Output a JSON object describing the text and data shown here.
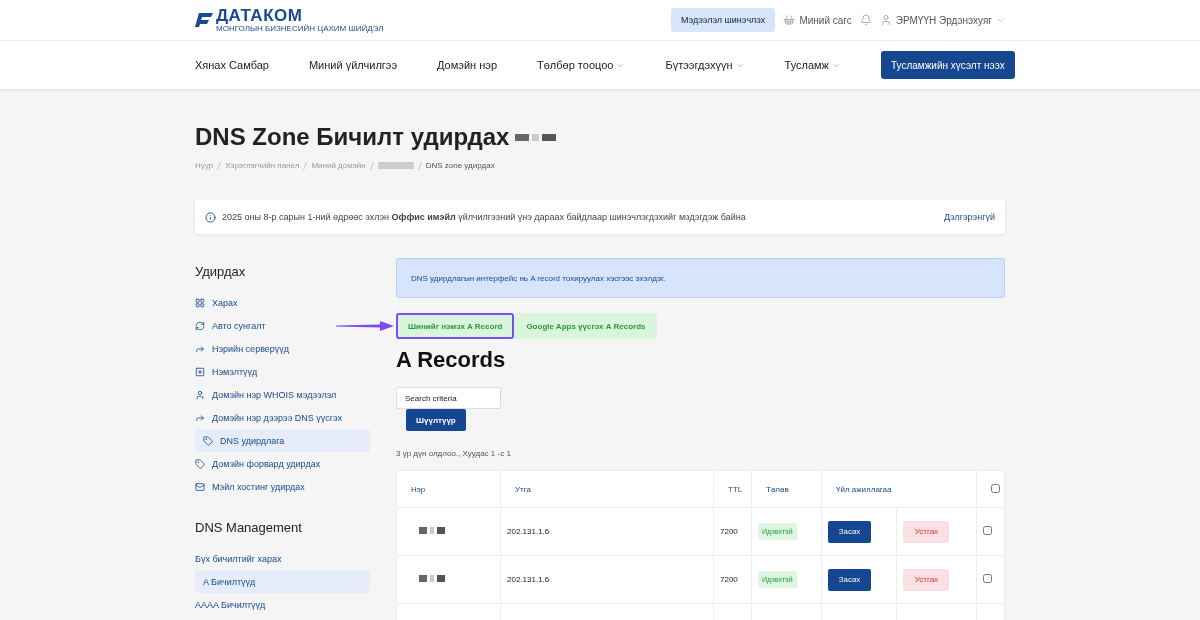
{
  "topbar": {
    "logo": "ДАТАКОМ",
    "logo_tagline": "МОНГОЛЫН БИЗНЕСИЙН ЦАХИМ ШИЙДЭЛ",
    "update_button": "Мэдээлэл шинэчлэх",
    "cart": "Миний сагс",
    "user": "ЭРМҮҮН Эрдэнэхуяг"
  },
  "nav": {
    "items": [
      {
        "label": "Хянах Самбар",
        "dropdown": false
      },
      {
        "label": "Миний үйлчилгээ",
        "dropdown": false
      },
      {
        "label": "Домэйн нэр",
        "dropdown": false
      },
      {
        "label": "Төлбөр тооцоо",
        "dropdown": true
      },
      {
        "label": "Бүтээгдэхүүн",
        "dropdown": true
      },
      {
        "label": "Тусламж",
        "dropdown": true
      }
    ],
    "support_button": "Тусламжийн хүсэлт нээх"
  },
  "header": {
    "title": "DNS Zone Бичилт удирдах",
    "title_redacted": true,
    "breadcrumb": [
      {
        "label": "Нүүр",
        "kind": "text"
      },
      {
        "label": "Хэрэглэгчийн панел",
        "kind": "text"
      },
      {
        "label": "Миний домэйн",
        "kind": "text"
      },
      {
        "kind": "redacted"
      },
      {
        "label": "DNS zone удирдах",
        "kind": "current"
      }
    ]
  },
  "notice": {
    "text": "2025 оны 8-р сарын 1-ний өдрөөс эхлэн **Оффис имэйл** үйлчилгээний үнэ дараах байдлаар шинэчлэгдэхийг мэдэгдэж байна",
    "link": "Дэлгэрэнгүй"
  },
  "sidebar": {
    "sections": [
      {
        "title": "Удирдах",
        "items": [
          {
            "label": "Харах",
            "kind": "dashboard",
            "selected": false
          },
          {
            "label": "Авто сунгалт",
            "kind": "refresh",
            "selected": false
          },
          {
            "label": "Нэрийн серверүүд",
            "kind": "share",
            "selected": false
          },
          {
            "label": "Нэмэлтүүд",
            "kind": "addons",
            "selected": false
          },
          {
            "label": "Домэйн нэр WHOIS мэдээлэл",
            "kind": "user",
            "selected": false
          },
          {
            "label": "Домэйн нэр дээрээ DNS үүсгэх",
            "kind": "share",
            "selected": false,
            "children": [
              {
                "label": "DNS удирдлага",
                "kind": "tag",
                "selected": true
              }
            ]
          },
          {
            "label": "Домэйн форвард удирдах",
            "kind": "tag",
            "selected": false
          },
          {
            "label": "Мэйл хостинг удирдах",
            "kind": "mail",
            "selected": false
          }
        ]
      },
      {
        "title": "DNS Management",
        "items": [
          {
            "label": "Бүх бичилтийг харах",
            "selected": false
          },
          {
            "label": "A Бичилтүүд",
            "selected": true
          },
          {
            "label": "AAAA Бичилтүүд",
            "selected": false
          }
        ]
      }
    ]
  },
  "content": {
    "info": "DNS удирдлагын интерфейс нь A record тохируулах хэсгээс эхэлдэг.",
    "action_buttons": [
      {
        "label": "Шинийг нэмэх A Record",
        "highlighted": true
      },
      {
        "label": "Google Apps үүсгэх A Records",
        "highlighted": false
      }
    ],
    "heading": "A Records",
    "search": {
      "placeholder": "Search criteria"
    },
    "filter_button": "Шүүлтүүр",
    "result_count": "3 үр дүн олдлоо., Хуудас 1 -с 1",
    "table": {
      "columns": [
        "Нэр",
        "Утга",
        "TTL",
        "Төлөв",
        "Үйл ажиллагаа"
      ],
      "header_checked": false,
      "rows": [
        {
          "name_redacted": true,
          "value": "202.131.1.6",
          "ttl": "7200",
          "status": "Идэвхтэй",
          "edit": "Засах",
          "delete": "Устгах",
          "checked": false
        },
        {
          "name_redacted": true,
          "value": "202.131.1.6",
          "ttl": "7200",
          "status": "Идэвхтэй",
          "edit": "Засах",
          "delete": "Устгах",
          "checked": false
        }
      ]
    }
  }
}
